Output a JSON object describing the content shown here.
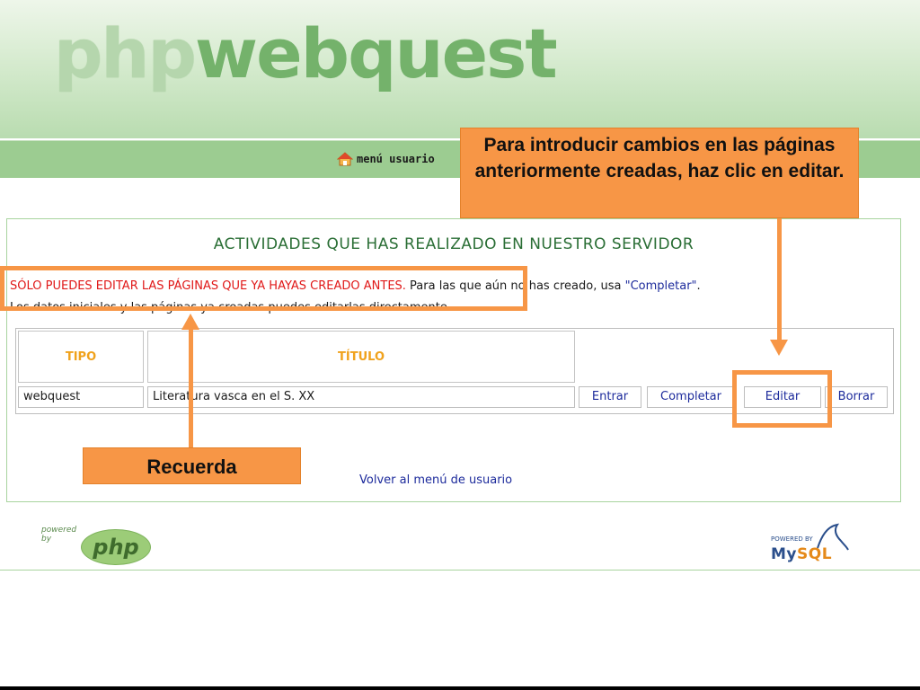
{
  "header": {
    "logo_prefix": "php",
    "logo_suffix": "webquest",
    "menu_link": "menú usuario",
    "menu_icon": "house-icon"
  },
  "main": {
    "title": "ACTIVIDADES QUE HAS REALIZADO EN NUESTRO SERVIDOR",
    "notice_red": "SÓLO PUEDES EDITAR LAS PÁGINAS QUE YA HAYAS CREADO ANTES.",
    "notice_part1": " Para las que aún no has creado, usa ",
    "notice_quote": "\"Completar\"",
    "notice_part2": ".",
    "notice_line2": "Los datos iniciales y las páginas ya creadas puedes editarlas directamente.",
    "table": {
      "headers": [
        "TIPO",
        "TÍTULO"
      ],
      "rows": [
        {
          "tipo": "webquest",
          "titulo": "Literatura vasca en el S. XX",
          "actions": [
            "Entrar",
            "Completar",
            "Editar",
            "Borrar"
          ]
        }
      ]
    },
    "back_link": "Volver al menú de usuario"
  },
  "footer": {
    "php_powered": "powered\nby",
    "php_logo": "php",
    "mysql_powered": "POWERED BY",
    "mysql_my": "My",
    "mysql_sql": "SQL"
  },
  "annotations": {
    "top_callout": "Para introducir cambios en las páginas anteriormente creadas, haz clic en editar.",
    "bottom_callout": "Recuerda"
  },
  "colors": {
    "accent_orange": "#f79646",
    "header_green": "#9ccc91",
    "title_green": "#2a6e35",
    "link_blue": "#1d2b9c",
    "warning_red": "#e01818",
    "header_label_orange": "#f0a21c"
  }
}
